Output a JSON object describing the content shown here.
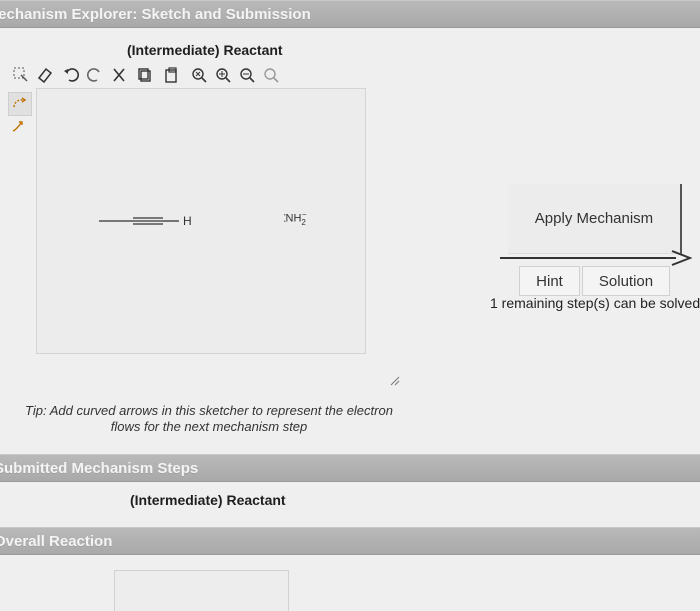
{
  "header": {
    "title": "lechanism Explorer: Sketch and Submission"
  },
  "sketcher": {
    "title": "(Intermediate) Reactant",
    "molecule_h": "H",
    "reagent": "NH",
    "reagent_sub": "2",
    "reagent_charge": "−"
  },
  "toolbar": {
    "tools": [
      "select-tool-icon",
      "eraser-icon",
      "undo-icon",
      "redo-icon",
      "cut-icon",
      "copy-icon",
      "paste-icon",
      "zoom-reset-icon",
      "zoom-in-icon",
      "zoom-out-icon",
      "zoom-fit-icon"
    ]
  },
  "side_tools": [
    "curved-arrow-double-icon",
    "curved-arrow-single-icon"
  ],
  "actions": {
    "apply_label": "Apply Mechanism",
    "hint_label": "Hint",
    "solution_label": "Solution",
    "remaining_text": "1 remaining step(s) can be solved"
  },
  "tip": {
    "line1": "Tip: Add curved arrows in this sketcher to represent the electron",
    "line2": "flows for the next mechanism step"
  },
  "submitted": {
    "header": "Submitted Mechanism Steps",
    "item_title": "(Intermediate) Reactant"
  },
  "overall": {
    "header": "Overall Reaction"
  },
  "colors": {
    "section_bar": "#ababab",
    "background": "#efefef"
  }
}
